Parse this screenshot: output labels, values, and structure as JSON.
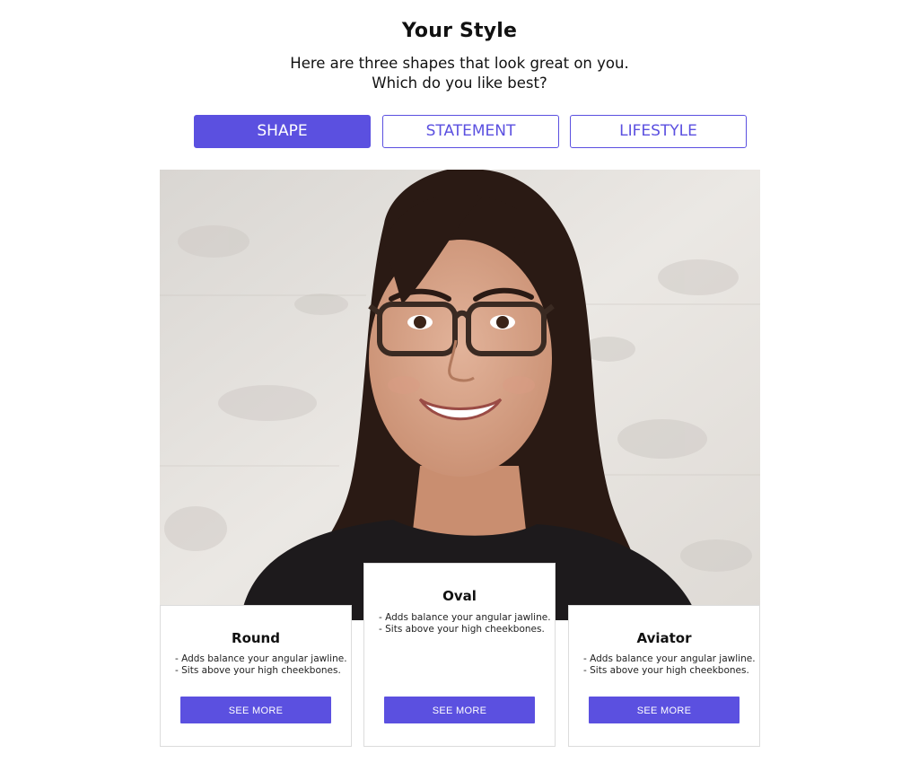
{
  "header": {
    "title": "Your Style",
    "subtitle_line1": "Here are three shapes that look great on you.",
    "subtitle_line2": "Which do you like best?"
  },
  "tabs": [
    {
      "label": "SHAPE",
      "active": true
    },
    {
      "label": "STATEMENT",
      "active": false
    },
    {
      "label": "LIFESTYLE",
      "active": false
    }
  ],
  "cards": [
    {
      "name": "Round",
      "points": [
        "- Adds balance your angular jawline.",
        "- Sits above your high cheekbones."
      ],
      "button_label": "SEE MORE"
    },
    {
      "name": "Oval",
      "points": [
        "- Adds balance your angular jawline.",
        "- Sits above your high cheekbones."
      ],
      "button_label": "SEE MORE"
    },
    {
      "name": "Aviator",
      "points": [
        "- Adds balance your angular jawline.",
        "- Sits above your high cheekbones."
      ],
      "button_label": "SEE MORE"
    }
  ],
  "colors": {
    "accent": "#5b50e0",
    "card_border": "#dcdcdc",
    "background": "#ffffff"
  }
}
